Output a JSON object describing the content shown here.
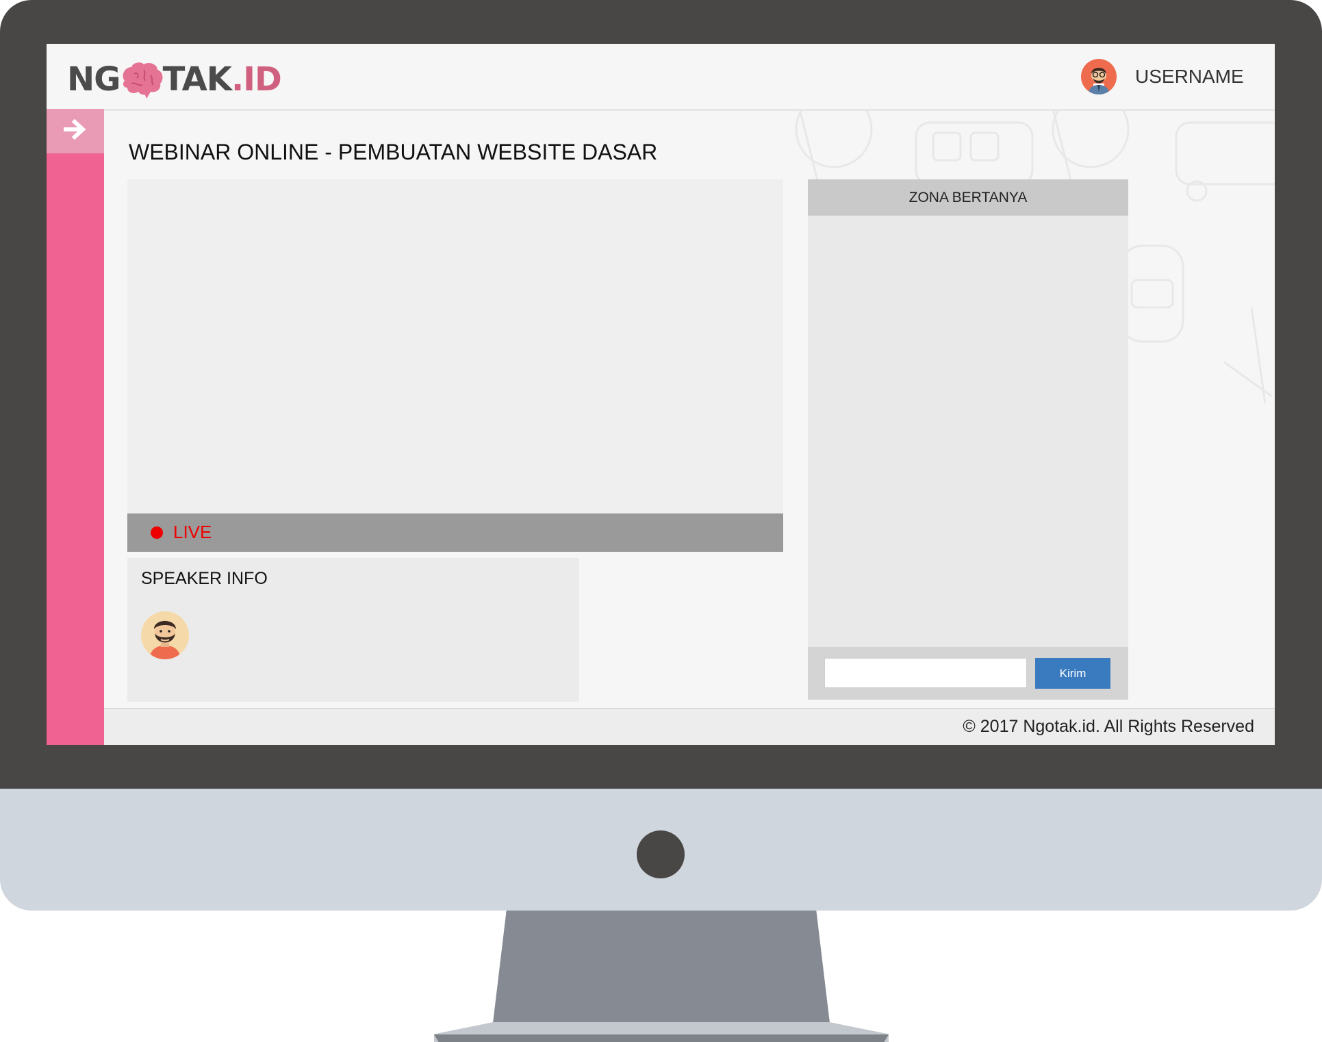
{
  "header": {
    "logo_left": "NG",
    "logo_right": "TAK",
    "logo_suffix": ".ID",
    "username": "USERNAME"
  },
  "sidebar": {
    "toggle_icon": "arrow-right-icon"
  },
  "main": {
    "title": "WEBINAR ONLINE - PEMBUATAN WEBSITE DASAR",
    "live_label": "LIVE",
    "speaker_title": "SPEAKER INFO"
  },
  "qa": {
    "title": "ZONA BERTANYA",
    "input_value": "",
    "send_label": "Kirim"
  },
  "footer": {
    "copyright": "© 2017 Ngotak.id. All Rights Reserved"
  },
  "colors": {
    "sidebar": "#f06292",
    "live": "#ee0000",
    "send_button": "#3a7bc0",
    "logo_accent": "#d06080"
  }
}
